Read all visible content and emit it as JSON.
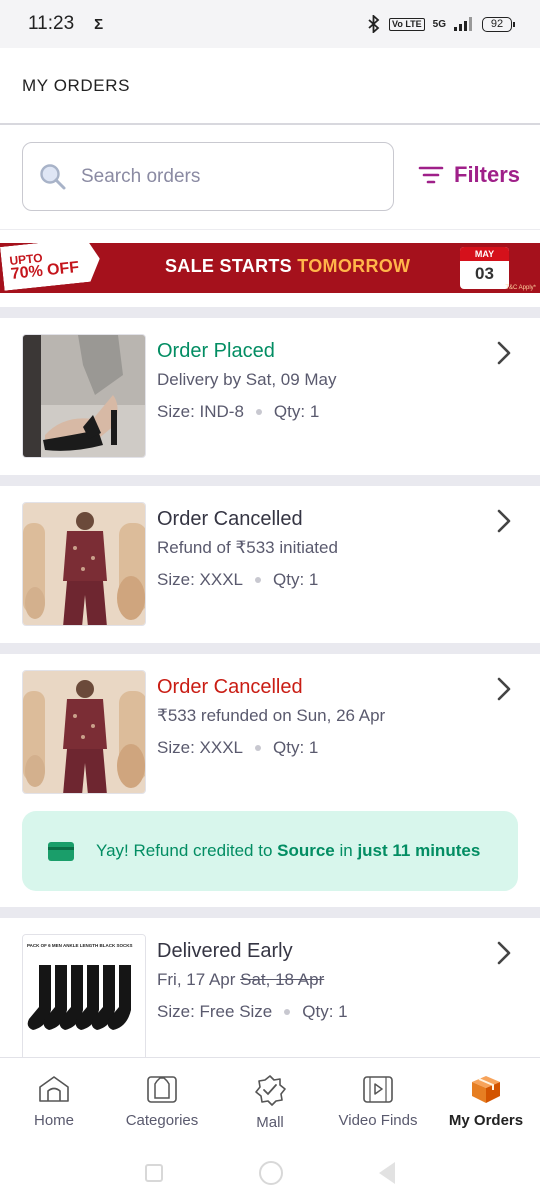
{
  "status_bar": {
    "time": "11:23",
    "sigma": "Σ",
    "network": "5G",
    "volte": "Vo LTE",
    "battery": "92"
  },
  "header": {
    "title": "MY ORDERS"
  },
  "search": {
    "placeholder": "Search orders",
    "filters_label": "Filters",
    "accent": "#9f2089"
  },
  "banner": {
    "tag_line1": "UPTO",
    "tag_line2": "70% OFF",
    "text_main": "SALE STARTS ",
    "text_highlight": "TOMORROW",
    "date_month": "MAY",
    "date_day": "03",
    "tnc": "T&C Apply*"
  },
  "orders": [
    {
      "status": "Order Placed",
      "status_color": "#038d63",
      "detail": "Delivery by Sat, 09 May",
      "size": "Size: IND-8",
      "qty": "Qty: 1"
    },
    {
      "status": "Order Cancelled",
      "status_color": "#353543",
      "detail": "Refund of ₹533 initiated",
      "size": "Size: XXXL",
      "qty": "Qty: 1"
    },
    {
      "status": "Order Cancelled",
      "status_color": "#c91d14",
      "detail": "₹533 refunded on Sun, 26 Apr",
      "size": "Size: XXXL",
      "qty": "Qty: 1",
      "refund_note": {
        "prefix": "Yay! Refund credited to ",
        "source": "Source",
        "middle": " in ",
        "time": "just 11 minutes"
      }
    },
    {
      "status": "Delivered Early",
      "status_color": "#353543",
      "detail": "Fri, 17 Apr ",
      "detail_strike": "Sat, 18 Apr",
      "size": "Size: Free Size",
      "qty": "Qty: 1",
      "thumb_caption": "PACK OF 6 MEN ANKLE LENGTH BLACK SOCKS"
    }
  ],
  "bottom_nav": [
    {
      "label": "Home",
      "icon": "home-icon"
    },
    {
      "label": "Categories",
      "icon": "categories-icon"
    },
    {
      "label": "Mall",
      "icon": "mall-icon"
    },
    {
      "label": "Video Finds",
      "icon": "video-icon"
    },
    {
      "label": "My Orders",
      "icon": "orders-box-icon",
      "active": true
    }
  ]
}
